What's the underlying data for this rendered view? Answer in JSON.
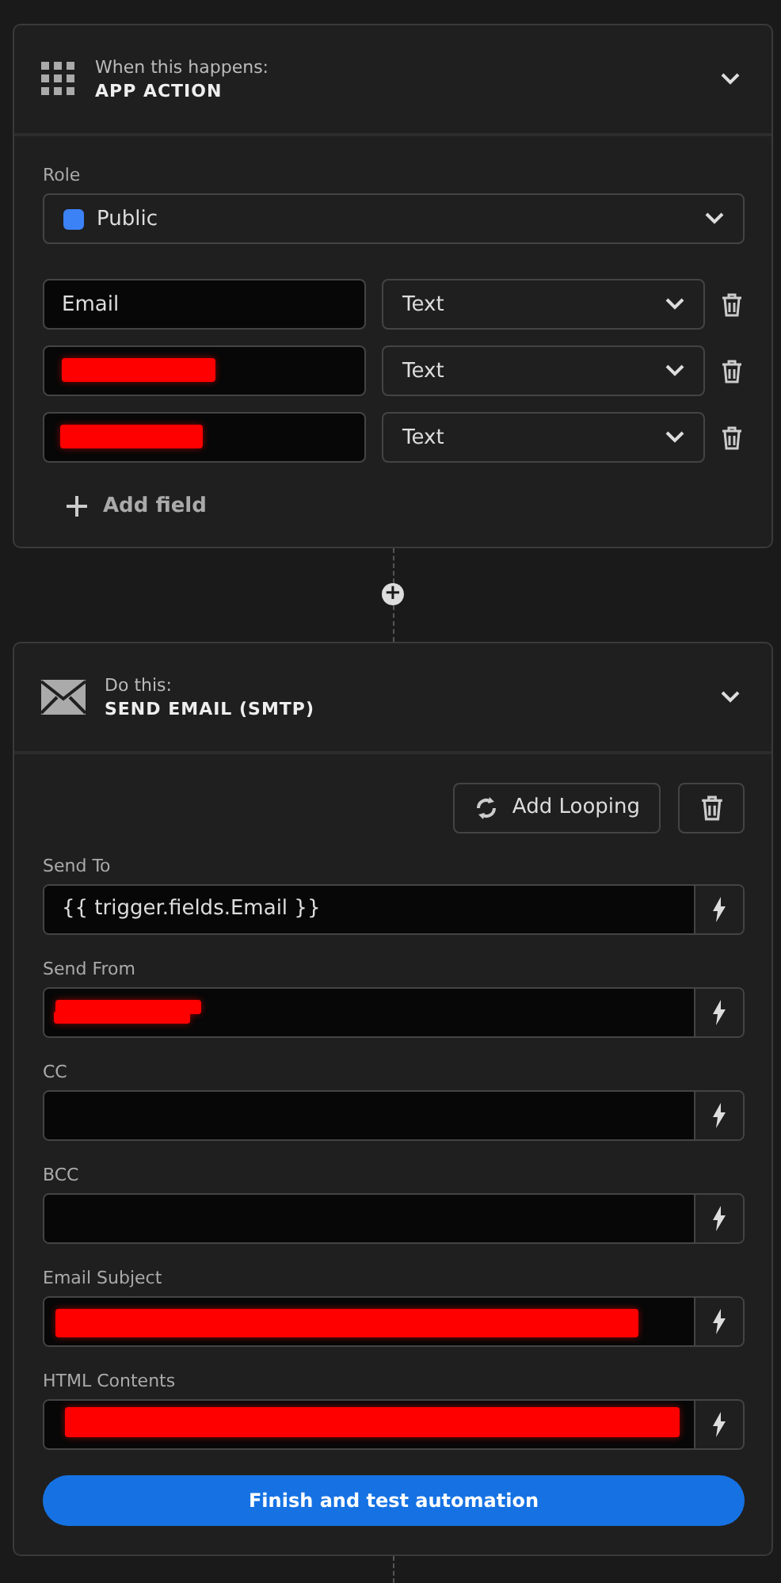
{
  "trigger": {
    "caption": "When this happens:",
    "title": "APP ACTION",
    "expanded": true,
    "role": {
      "label": "Role",
      "value": "Public",
      "color": "#3b82f6"
    },
    "fields": [
      {
        "name": "Email",
        "type": "Text"
      },
      {
        "redacted": true,
        "type": "Text"
      },
      {
        "redacted": true,
        "type": "Text"
      }
    ],
    "add_field": "Add field"
  },
  "connector": {
    "symbol": "+"
  },
  "action": {
    "caption": "Do this:",
    "title": "SEND EMAIL (SMTP)",
    "expanded": true,
    "looping": "Add Looping",
    "inputs": [
      {
        "label": "Send To",
        "value": "{{ trigger.fields.Email }}"
      },
      {
        "label": "Send From",
        "redacted": true
      },
      {
        "label": "CC"
      },
      {
        "label": "BCC"
      },
      {
        "label": "Email Subject",
        "redacted": true
      },
      {
        "label": "HTML Contents",
        "redacted": true
      }
    ],
    "submit": "Finish and test automation"
  }
}
